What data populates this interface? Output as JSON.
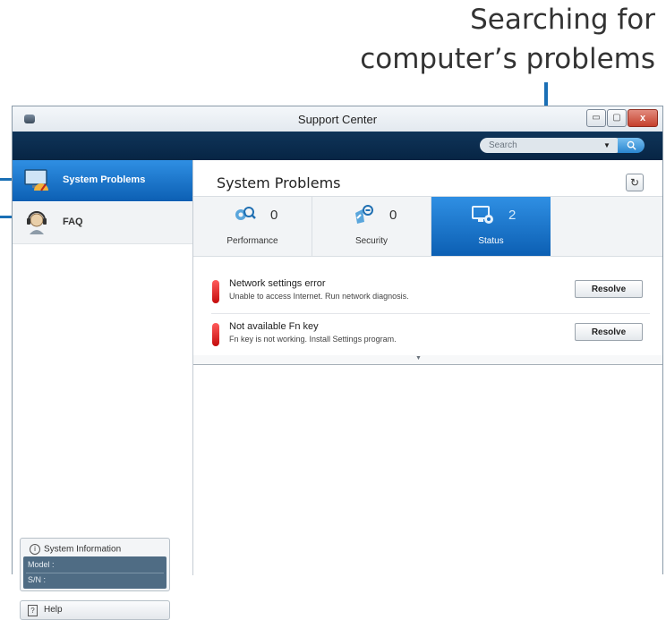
{
  "callout": {
    "line1": "Searching for",
    "line2": "computer’s problems"
  },
  "window": {
    "title": "Support Center",
    "controls": {
      "minimize": "▭",
      "maximize": "▢",
      "close": "x"
    }
  },
  "search": {
    "placeholder": "Search"
  },
  "sidebar": {
    "items": [
      {
        "label": "System Problems",
        "icon": "monitor-gauge-icon",
        "active": true
      },
      {
        "label": "FAQ",
        "icon": "headset-person-icon",
        "active": false
      }
    ],
    "system_information": {
      "heading": "System Information",
      "model_label": "Model :",
      "sn_label": "S/N :"
    },
    "help_label": "Help"
  },
  "main": {
    "title": "System Problems",
    "tabs": [
      {
        "label": "Performance",
        "count": "0",
        "icon": "gears-search-icon"
      },
      {
        "label": "Security",
        "count": "0",
        "icon": "shield-icon"
      },
      {
        "label": "Status",
        "count": "2",
        "icon": "monitor-settings-icon",
        "active": true
      }
    ],
    "problems": [
      {
        "title": "Network settings error",
        "description": "Unable to access Internet. Run network diagnosis.",
        "action": "Resolve",
        "severity_color": "#e0141b"
      },
      {
        "title": "Not available Fn key",
        "description": "Fn key is not working. Install Settings program.",
        "action": "Resolve",
        "severity_color": "#e0141b"
      }
    ]
  },
  "colors": {
    "accent_blue": "#1a7ed8",
    "navbar": "#0b2c4e",
    "callout_line": "#1a6fb5"
  }
}
